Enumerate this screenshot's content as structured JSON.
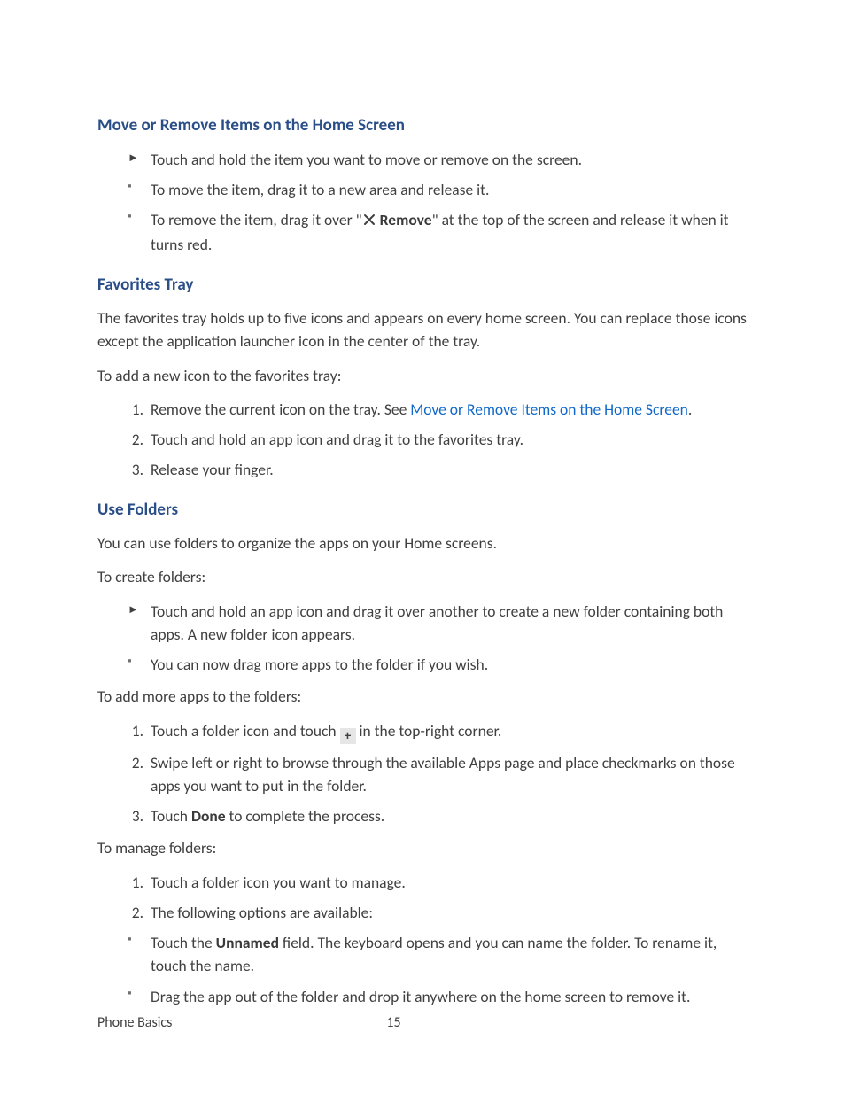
{
  "sections": {
    "move_remove": {
      "heading": "Move or Remove Items on the Home Screen",
      "top_item": "Touch and hold the item you want to move or remove on the screen.",
      "sub1": "To move the item, drag it to a new area and release it.",
      "sub2_pre": "To remove the item, drag it over \"",
      "sub2_remove_label": "Remove",
      "sub2_post": "\" at the top of the screen and release it when it turns red."
    },
    "favorites": {
      "heading": "Favorites Tray",
      "p1": "The favorites tray holds up to five icons and appears on every home screen. You can replace those icons except the application launcher icon in the center of the tray.",
      "p2": "To add a new icon to the favorites tray:",
      "li1_pre": "Remove the current icon on the tray. See ",
      "li1_link": "Move or Remove Items on the Home Screen",
      "li1_post": ".",
      "li2": "Touch and hold an app icon and drag it to the favorites tray.",
      "li3": "Release your finger."
    },
    "folders": {
      "heading": "Use Folders",
      "p1": "You can use folders to organize the apps on your Home screens.",
      "p2": "To create folders:",
      "create_top": "Touch and hold an app icon and drag it over another to create a new folder containing both apps. A new folder icon appears.",
      "create_sub": "You can now drag more apps to the folder if you wish.",
      "p3": "To add more apps to the folders:",
      "add1_pre": "Touch a folder icon and touch ",
      "add1_post": " in the top-right corner.",
      "add2": "Swipe left or right to browse through the available Apps page and place checkmarks on those apps you want to put in the folder.",
      "add3_pre": "Touch ",
      "add3_bold": "Done",
      "add3_post": " to complete the process.",
      "p4": "To manage folders:",
      "mg1": "Touch a folder icon you want to manage.",
      "mg2": "The following options are available:",
      "mg2_sub1_pre": "Touch the ",
      "mg2_sub1_bold": "Unnamed",
      "mg2_sub1_post": " field. The keyboard opens and you can name the folder. To rename it, touch the name.",
      "mg2_sub2": "Drag the app out of the folder and drop it anywhere on the home screen to remove it."
    }
  },
  "footer": {
    "section_name": "Phone Basics",
    "page_number": "15"
  }
}
